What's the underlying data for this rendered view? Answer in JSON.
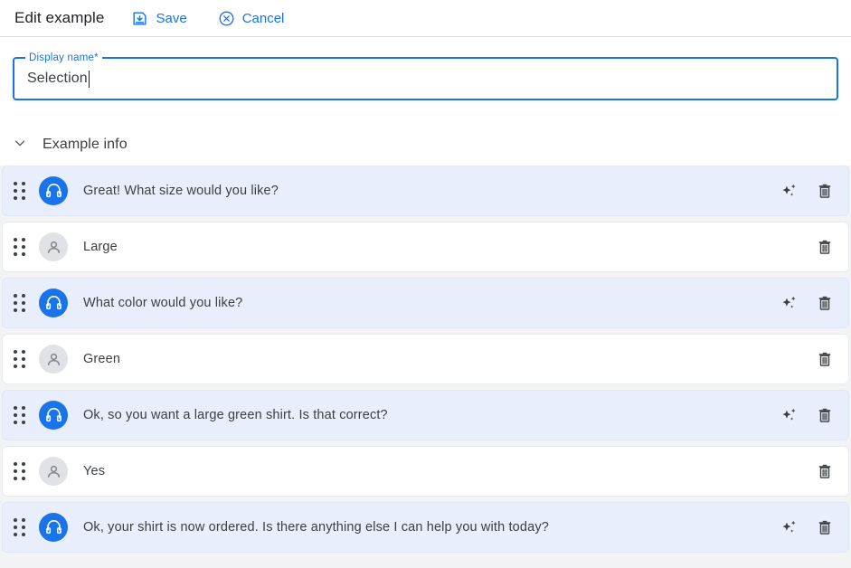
{
  "header": {
    "title": "Edit example",
    "save_label": "Save",
    "cancel_label": "Cancel",
    "save_icon": "save-icon",
    "cancel_icon": "cancel-circle-icon"
  },
  "form": {
    "display_name": {
      "label": "Display name*",
      "value": "Selection",
      "placeholder": ""
    }
  },
  "section": {
    "title": "Example info",
    "expand_icon": "chevron-down-icon",
    "expanded": true
  },
  "colors": {
    "accent": "#1a73e8",
    "agent_row_bg": "#e8eefc",
    "user_row_bg": "#ffffff",
    "page_bg": "#f1f3f4",
    "text": "#3c4043"
  },
  "conversation": {
    "drag_icon": "drag-handle-icon",
    "sparkle_icon": "sparkle-icon",
    "delete_icon": "trash-icon",
    "agent_avatar_icon": "headset-icon",
    "user_avatar_icon": "person-icon",
    "rows": [
      {
        "speaker": "agent",
        "text": "Great! What size would you like?",
        "has_sparkle": true,
        "has_delete": true
      },
      {
        "speaker": "user",
        "text": "Large",
        "has_sparkle": false,
        "has_delete": true
      },
      {
        "speaker": "agent",
        "text": "What color would you like?",
        "has_sparkle": true,
        "has_delete": true
      },
      {
        "speaker": "user",
        "text": "Green",
        "has_sparkle": false,
        "has_delete": true
      },
      {
        "speaker": "agent",
        "text": "Ok, so you want a large green shirt. Is that correct?",
        "has_sparkle": true,
        "has_delete": true
      },
      {
        "speaker": "user",
        "text": "Yes",
        "has_sparkle": false,
        "has_delete": true
      },
      {
        "speaker": "agent",
        "text": "Ok, your shirt is now ordered. Is there anything else I can help you with today?",
        "has_sparkle": true,
        "has_delete": true
      }
    ]
  }
}
